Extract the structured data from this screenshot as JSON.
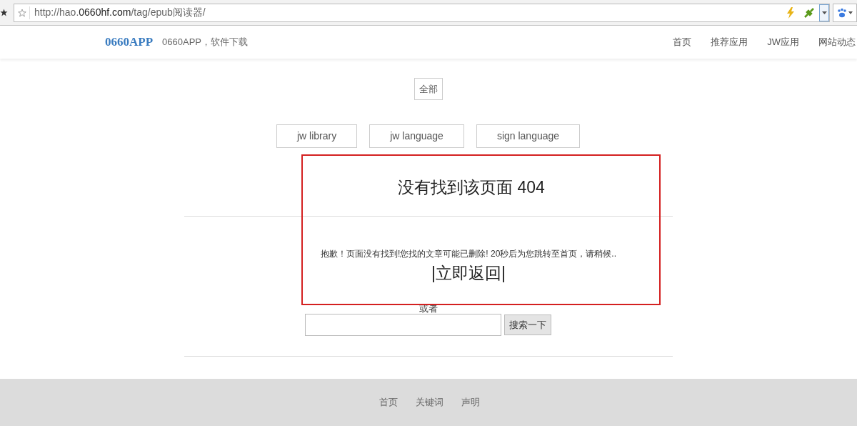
{
  "browser": {
    "url": "http://hao.**0660hf.com**/tag/epub阅读器/"
  },
  "header": {
    "logo": "0660APP",
    "tagline": "0660APP，软件下载",
    "nav": [
      {
        "label": "首页"
      },
      {
        "label": "推荐应用"
      },
      {
        "label": "JW应用"
      },
      {
        "label": "网站动态"
      }
    ]
  },
  "filter": {
    "all": "全部",
    "tags": [
      "jw library",
      "jw language",
      "sign language"
    ]
  },
  "error": {
    "title": "没有找到该页面 404",
    "message": "抱歉！页面没有找到!您找的文章可能已删除! 20秒后为您跳转至首页，请稍候..",
    "back_link": "|立即返回|",
    "or": "或者",
    "search_button": "搜索一下"
  },
  "footer": {
    "links": [
      "首页",
      "关键词",
      "声明"
    ]
  }
}
